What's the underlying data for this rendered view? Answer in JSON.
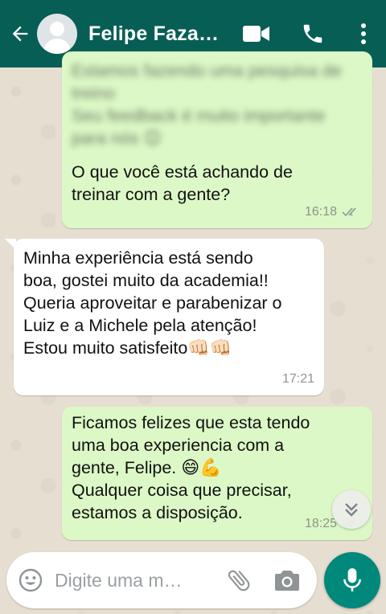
{
  "header": {
    "contact_name": "Felipe Faza…",
    "back_icon": "arrow-left-icon",
    "video_icon": "video-call-icon",
    "call_icon": "phone-icon",
    "menu_icon": "more-vertical-icon",
    "color": "#075e55"
  },
  "messages": [
    {
      "direction": "outgoing",
      "blurred_lines": [
        "Estamos fazendo uma pesquisa de",
        "treino",
        "Seu feedback é muito importante",
        "para nós"
      ],
      "blurred_emoji": "😊",
      "lines": [
        "O que você está achando de",
        "treinar com a gente?"
      ],
      "time": "16:18",
      "status": "read"
    },
    {
      "direction": "incoming",
      "lines": [
        "Minha experiência está sendo",
        "boa, gostei muito da academia!!",
        "Queria aproveitar e parabenizar o",
        "Luiz e a Michele pela atenção!",
        "Estou muito satisfeito"
      ],
      "trailing_emoji": "👊🏻👊🏻",
      "time": "17:21"
    },
    {
      "direction": "outgoing",
      "lines": [
        "Ficamos felizes que esta tendo",
        "uma boa experiencia com a",
        "gente, Felipe.",
        "Qualquer coisa que precisar,",
        "estamos a disposição."
      ],
      "inline_emoji": "😄💪",
      "time": "18:25",
      "status": "read"
    }
  ],
  "composer": {
    "placeholder": "Digite uma m…",
    "emoji_icon": "emoji-icon",
    "attach_icon": "paperclip-icon",
    "camera_icon": "camera-icon",
    "mic_icon": "microphone-icon",
    "mic_color": "#00897b"
  },
  "scroll_down_icon": "double-chevron-down-icon",
  "colors": {
    "outgoing_bubble": "#dcf8c6",
    "incoming_bubble": "#ffffff",
    "chat_background": "#e7ded2"
  }
}
